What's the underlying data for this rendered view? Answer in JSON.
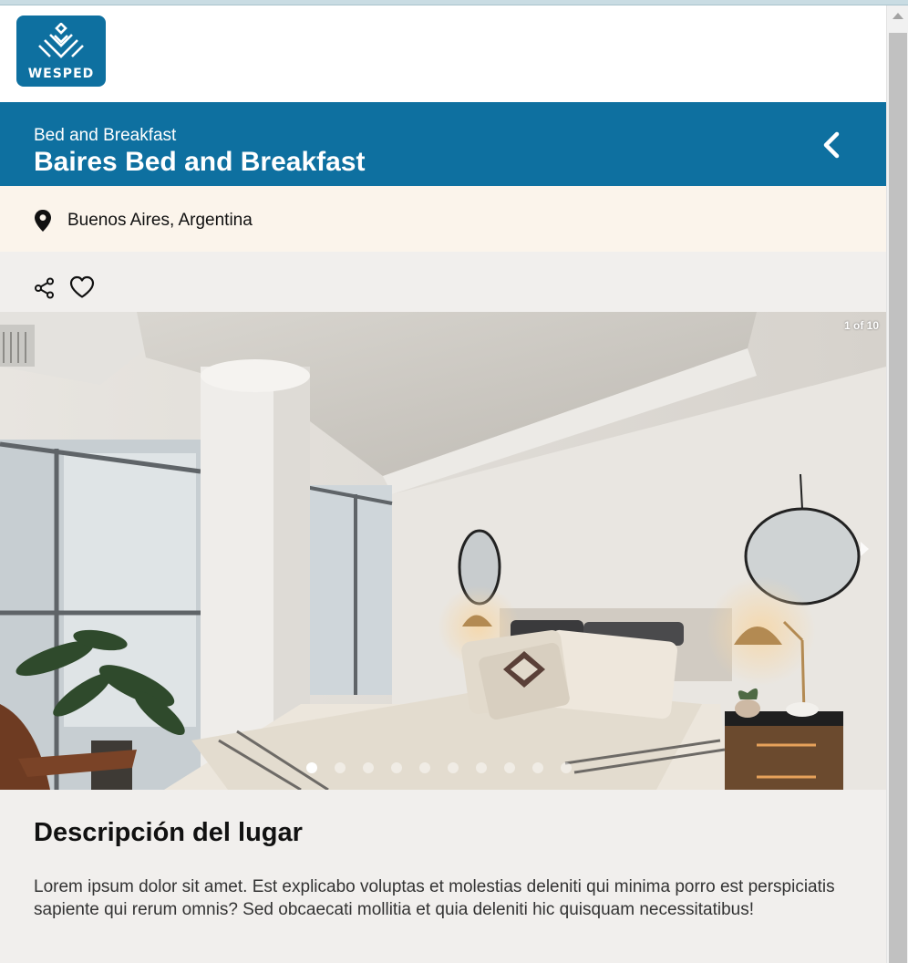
{
  "header": {
    "logo_text": "WESPED"
  },
  "listing": {
    "category": "Bed and Breakfast",
    "title": "Baires Bed and Breakfast",
    "location": "Buenos Aires, Argentina"
  },
  "gallery": {
    "counter": "1 of 10",
    "total_slides": 10,
    "active_slide": 1
  },
  "description": {
    "heading": "Descripción del lugar",
    "body": "Lorem ipsum dolor sit amet. Est explicabo voluptas et molestias deleniti qui minima porro est perspiciatis sapiente qui rerum omnis? Sed obcaecati mollitia et quia deleniti hic quisquam necessitatibus!"
  },
  "icons": {
    "back": "chevron-left-icon",
    "location": "map-pin-icon",
    "share": "share-icon",
    "favorite": "heart-icon"
  },
  "colors": {
    "brand": "#0e70a0",
    "location_bg": "#fbf4eb",
    "section_bg": "#f1efed"
  }
}
